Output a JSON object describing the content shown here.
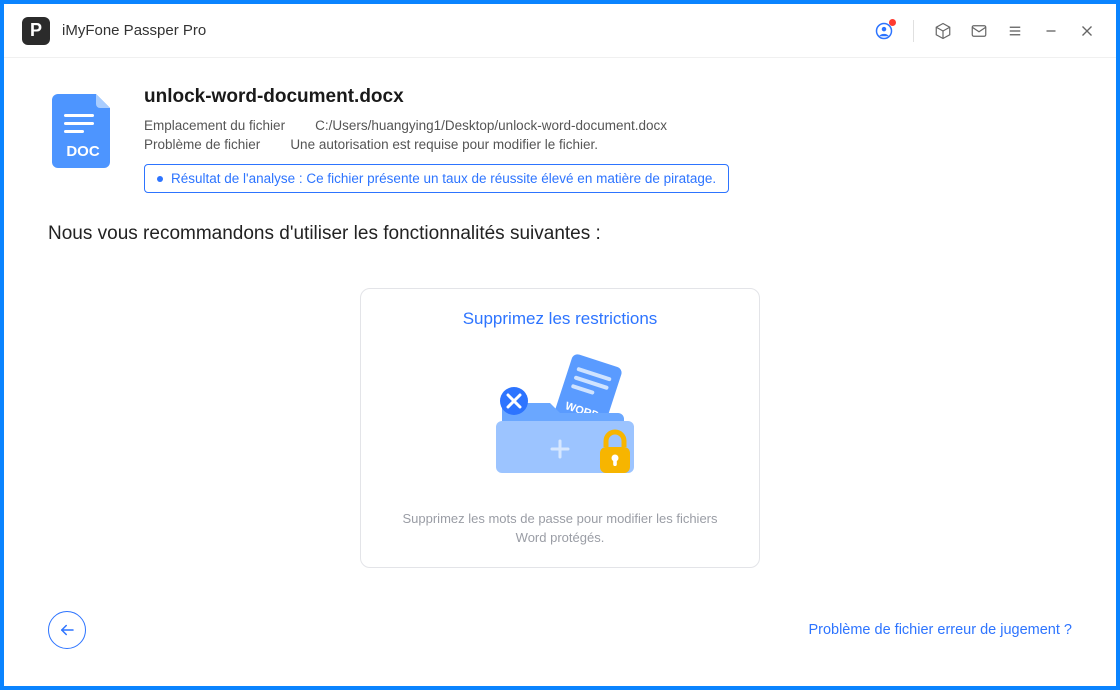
{
  "app": {
    "title": "iMyFone Passper Pro"
  },
  "file": {
    "name": "unlock-word-document.docx",
    "location_label": "Emplacement du fichier",
    "location_value": "C:/Users/huangying1/Desktop/unlock-word-document.docx",
    "issue_label": "Problème de fichier",
    "issue_value": "Une autorisation est requise pour modifier le fichier.",
    "analysis": "Résultat de l'analyse : Ce fichier présente un taux de réussite élevé en matière de piratage."
  },
  "recommend_heading": "Nous vous recommandons d'utiliser les fonctionnalités suivantes :",
  "card": {
    "title": "Supprimez les restrictions",
    "description": "Supprimez les mots de passe pour modifier les fichiers Word protégés."
  },
  "footer": {
    "help_link": "Problème de fichier erreur de jugement ?"
  },
  "icons": {
    "doc_label": "DOC"
  }
}
